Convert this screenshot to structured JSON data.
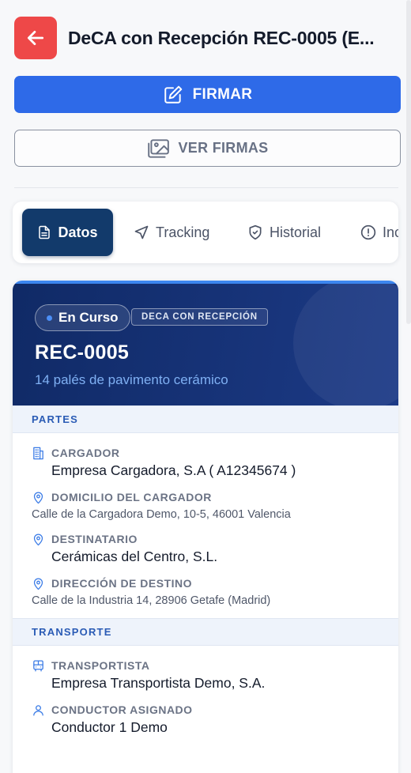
{
  "header": {
    "title": "DeCA con Recepción REC-0005 (E..."
  },
  "actions": {
    "sign_label": "FIRMAR",
    "view_signatures_label": "VER FIRMAS"
  },
  "tabs": [
    {
      "label": "Datos",
      "icon": "document-icon",
      "active": true
    },
    {
      "label": "Tracking",
      "icon": "navigation-arrow-icon",
      "active": false
    },
    {
      "label": "Historial",
      "icon": "shield-icon",
      "active": false
    },
    {
      "label": "Inc",
      "icon": "alert-circle-icon",
      "active": false
    }
  ],
  "summary": {
    "status": "En Curso",
    "type": "DECA CON RECEPCIÓN",
    "reference": "REC-0005",
    "description": "14 palés de pavimento cerámico"
  },
  "sections": {
    "partes": {
      "title": "PARTES",
      "cargador_label": "CARGADOR",
      "cargador_value": "Empresa Cargadora, S.A ( A12345674 )",
      "domicilio_label": "DOMICILIO DEL CARGADOR",
      "domicilio_value": "Calle de la Cargadora Demo, 10-5, 46001 Valencia",
      "destinatario_label": "DESTINATARIO",
      "destinatario_value": "Cerámicas del Centro, S.L.",
      "direccion_label": "DIRECCIÓN DE DESTINO",
      "direccion_value": "Calle de la Industria 14, 28906 Getafe (Madrid)"
    },
    "transporte": {
      "title": "TRANSPORTE",
      "transportista_label": "TRANSPORTISTA",
      "transportista_value": "Empresa Transportista Demo, S.A.",
      "conductor_label": "CONDUCTOR ASIGNADO",
      "conductor_value": "Conductor 1 Demo"
    }
  },
  "colors": {
    "accent": "#2e6ae8",
    "back": "#ee4848",
    "hero": "#102a66",
    "active_tab": "#123a6b"
  }
}
